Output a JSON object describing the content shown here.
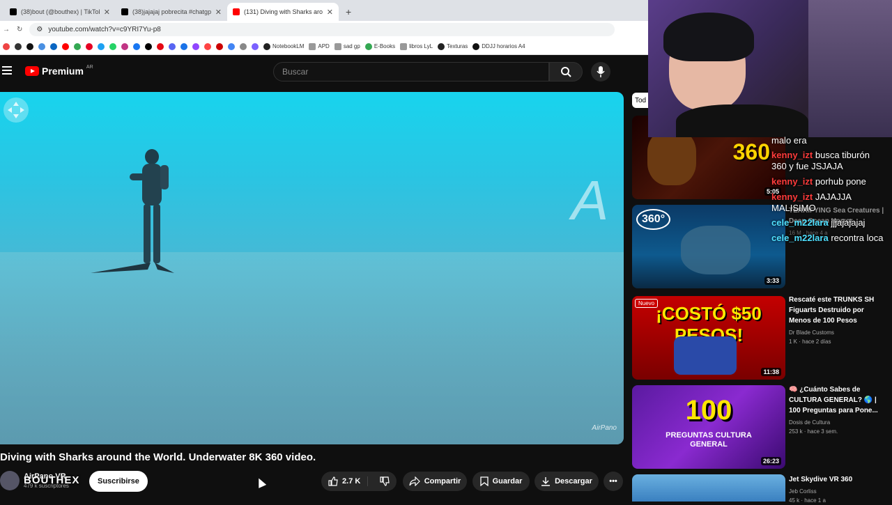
{
  "browser": {
    "tabs": [
      {
        "title": "(38)bout (@bouthex) | TikTok"
      },
      {
        "title": "(38)jajajaj pobrecita #chatgpt #"
      },
      {
        "title": "(131) Diving with Sharks aroun..."
      }
    ],
    "url": "youtube.com/watch?v=c9YRI7Yu-p8",
    "bookmarks": [
      "NotebookLM",
      "APD",
      "sad gp",
      "E-Books",
      "libros LyL",
      "Texturas",
      "DDJJ horarios A4"
    ]
  },
  "yt": {
    "logo_text": "Premium",
    "region": "AR",
    "search_placeholder": "Buscar"
  },
  "video": {
    "title": "Diving with Sharks around the World. Underwater 8K 360 video.",
    "watermark": "AirPano",
    "channel": "AirPano VR",
    "subscribers": "479 k suscriptores",
    "subscribe_label": "Suscribirse",
    "likes": "2.7 K",
    "share_label": "Compartir",
    "save_label": "Guardar",
    "download_label": "Descargar",
    "overlay_text": "BOUTHEX"
  },
  "sidebar": {
    "chip": "Tod",
    "items": [
      {
        "duration": "5:05",
        "badge": "360",
        "title": "",
        "channel": "...ckTV",
        "meta": "95 M · hace 10 a"
      },
      {
        "duration": "3:33",
        "badge": "360°",
        "title": "TERRIFYING Sea Creatures | Deep Ocean Horror",
        "channel": "",
        "meta": "16 M · hace 4 a"
      },
      {
        "duration": "11:38",
        "badge": "Nuevo",
        "title": "Rescaté este TRUNKS SH Figuarts Destruido por Menos de 100 Pesos",
        "channel": "Dr Blade Customs",
        "meta": "1 K · hace 2 días"
      },
      {
        "duration": "26:23",
        "badge": "100",
        "title": "🧠 ¿Cuánto Sabes de CULTURA GENERAL? 🌎 | 100 Preguntas para Pone...",
        "channel": "Dosis de Cultura",
        "meta": "253 k · hace 3 sem."
      },
      {
        "duration": "",
        "badge": "",
        "title": "Jet Skydive VR 360",
        "channel": "Jeb Corliss",
        "meta": "45 k · hace 1 a"
      }
    ],
    "thumb1_big": "360",
    "thumb3_text": "¡COSTÓ $50 PESOS!",
    "thumb4_sub": "PREGUNTAS CULTURA GENERAL"
  },
  "chat": [
    {
      "user": "",
      "msg": "malo era"
    },
    {
      "user": "kenny_izt",
      "msg": "busca tiburón 360 y fue JSJAJA"
    },
    {
      "user": "kenny_izt",
      "msg": "porhub pone"
    },
    {
      "user": "kenny_izt",
      "msg": "JAJAJJA MALISIMO"
    },
    {
      "user": "cele_m22lara",
      "msg": "jjjajajajaj"
    },
    {
      "user": "cele_m22lara",
      "msg": "recontra loca"
    }
  ],
  "colors": {
    "yt_red": "#ff0000",
    "chat_red": "#ff3b3b",
    "chat_cyan": "#4fe0ff"
  }
}
